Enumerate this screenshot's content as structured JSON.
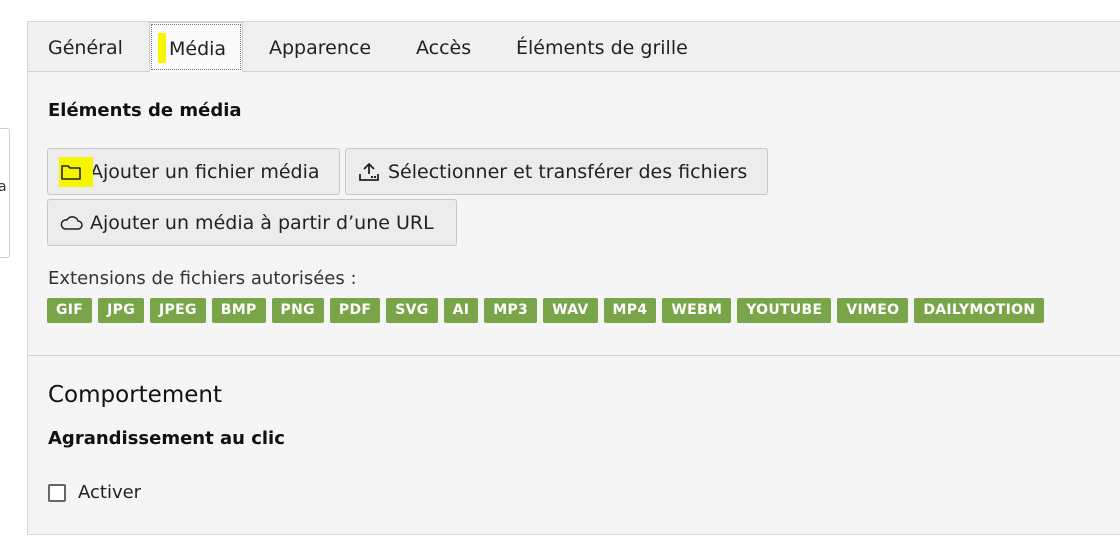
{
  "side_stub_glyph": "a",
  "tabs": [
    {
      "label": "Général"
    },
    {
      "label": "Média"
    },
    {
      "label": "Apparence"
    },
    {
      "label": "Accès"
    },
    {
      "label": "Éléments de grille"
    }
  ],
  "media": {
    "section_title": "Eléments de média",
    "buttons": {
      "add_file": {
        "label": "Ajouter un fichier média",
        "icon": "folder-icon"
      },
      "upload": {
        "label": "Sélectionner et transférer des fichiers",
        "icon": "upload-icon"
      },
      "add_url": {
        "label": "Ajouter un média à partir d’une URL",
        "icon": "cloud-icon"
      }
    },
    "extensions_label": "Extensions de fichiers autorisées :",
    "extensions": [
      "GIF",
      "JPG",
      "JPEG",
      "BMP",
      "PNG",
      "PDF",
      "SVG",
      "AI",
      "MP3",
      "WAV",
      "MP4",
      "WEBM",
      "YOUTUBE",
      "VIMEO",
      "DAILYMOTION"
    ]
  },
  "behavior": {
    "title": "Comportement",
    "subtitle": "Agrandissement au clic",
    "checkbox_label": "Activer",
    "checked": false
  },
  "colors": {
    "badge": "#79a548",
    "highlight": "#f5f500"
  }
}
